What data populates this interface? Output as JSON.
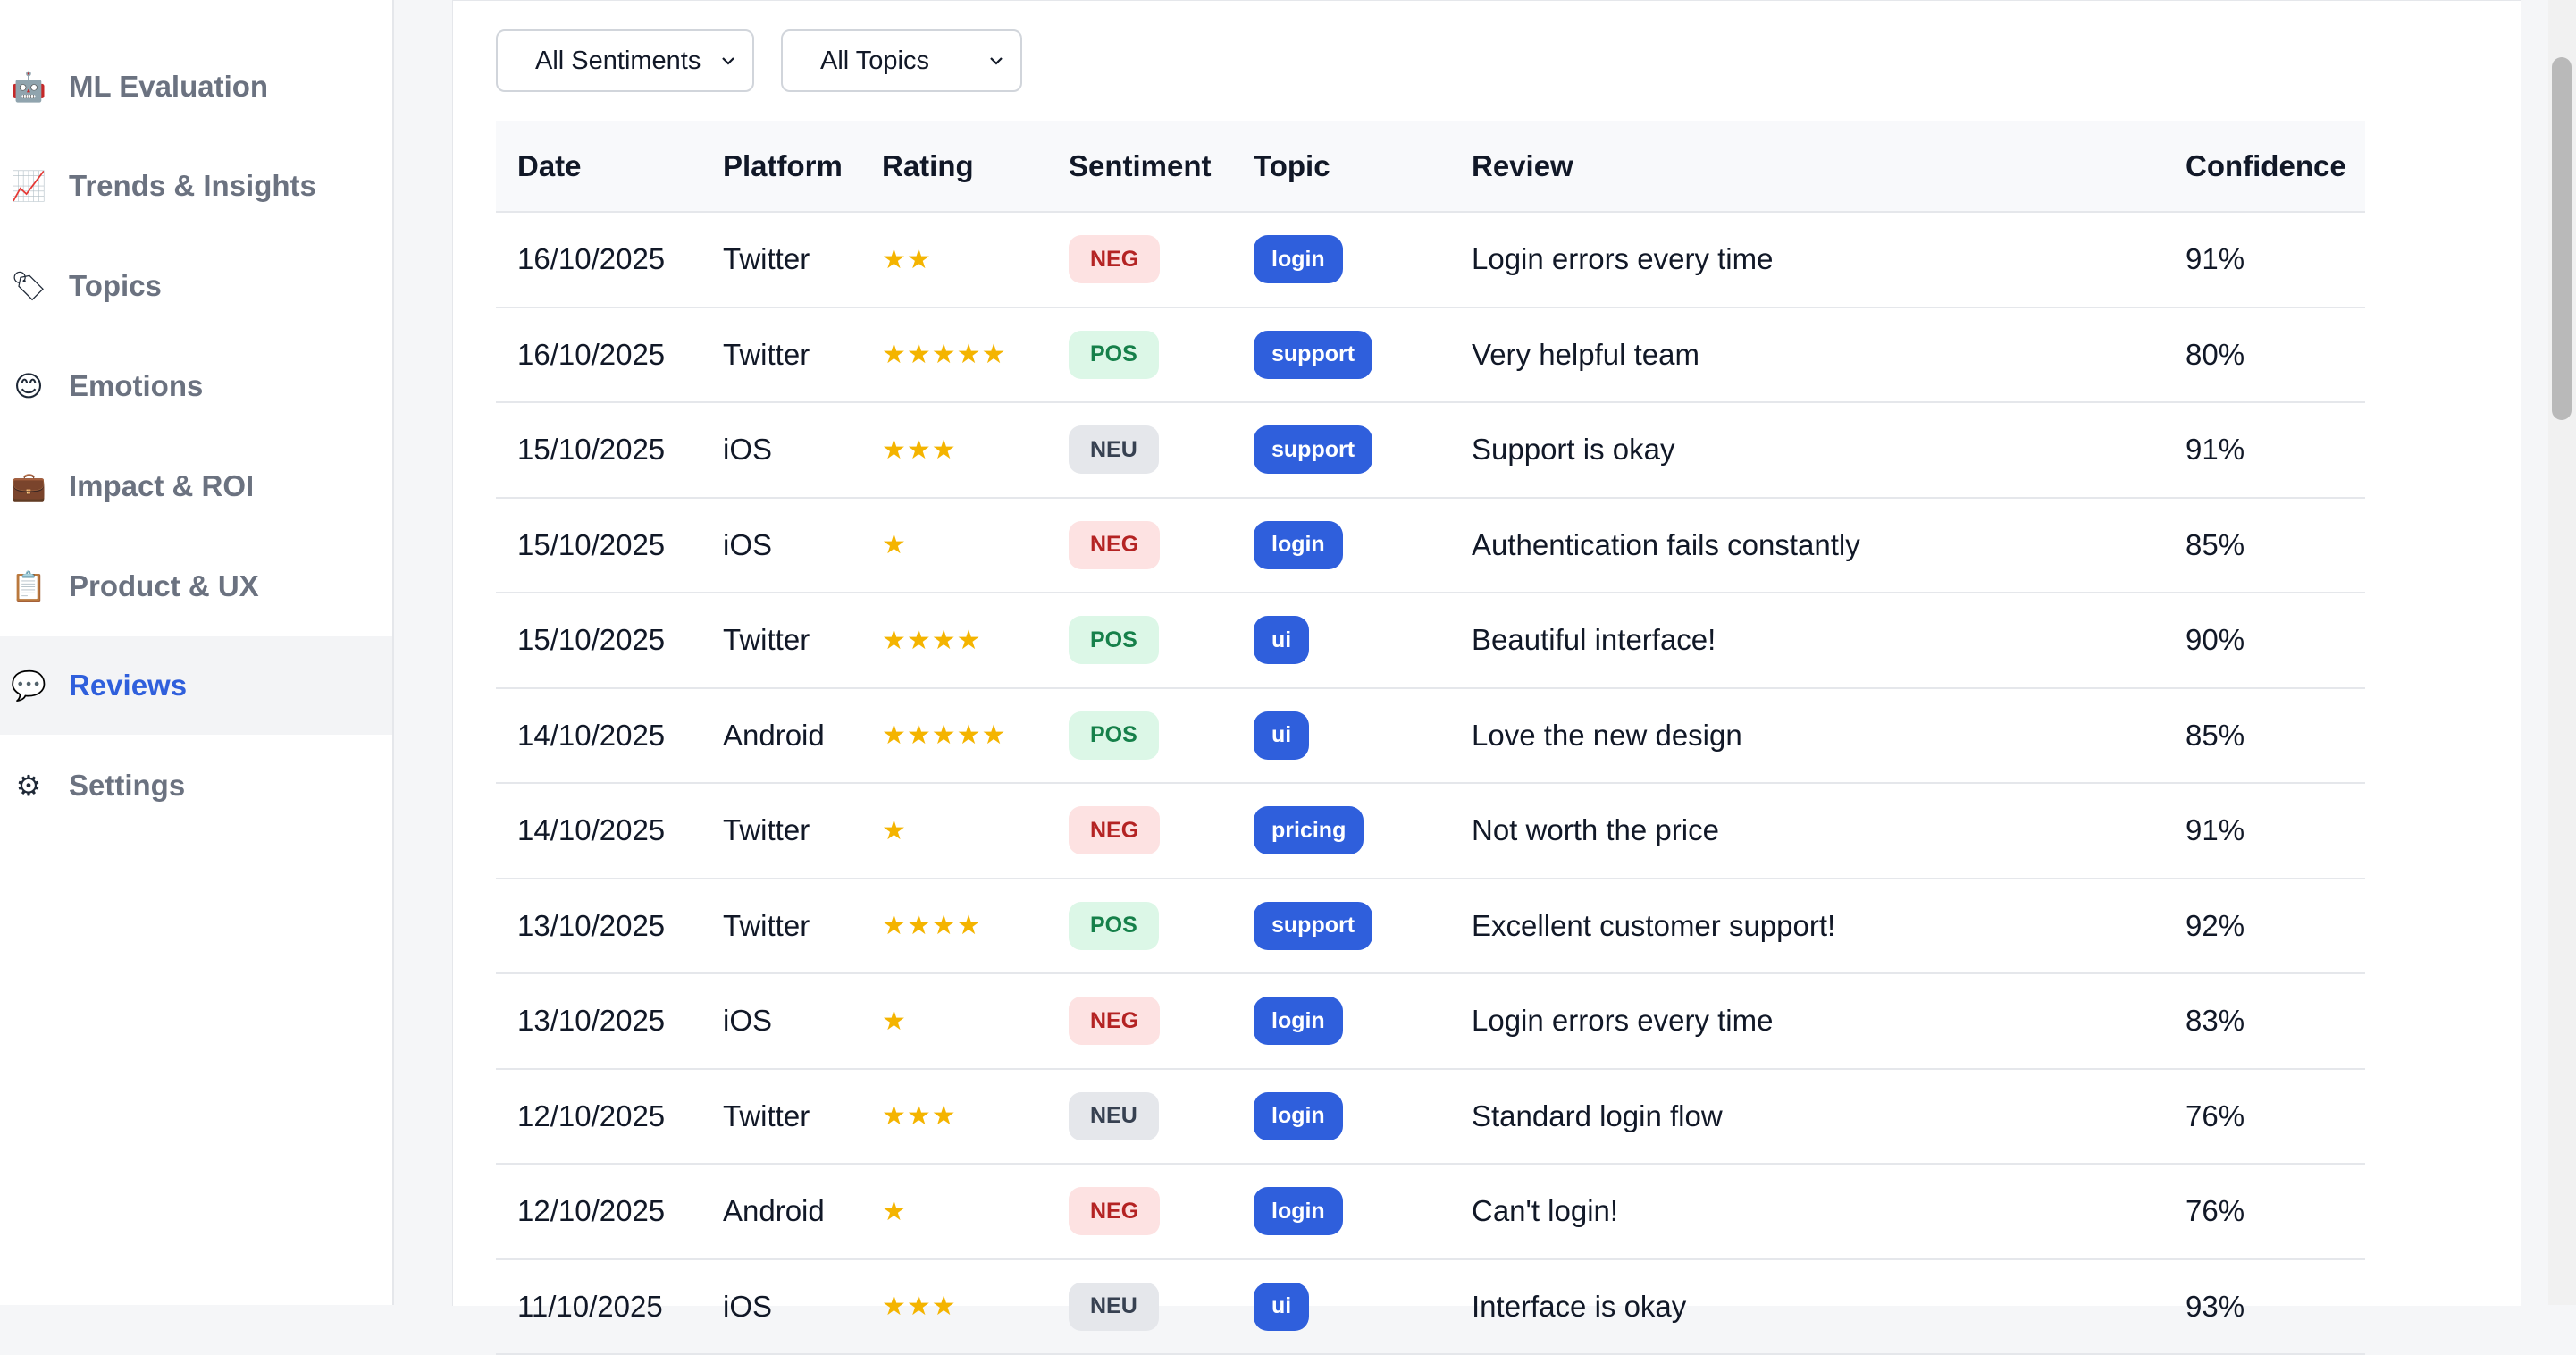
{
  "sidebar": {
    "items": [
      {
        "icon": "robot-icon",
        "glyph": "🤖",
        "label": "ML Evaluation",
        "active": false
      },
      {
        "icon": "chart-increasing-icon",
        "glyph": "📈",
        "label": "Trends & Insights",
        "active": false
      },
      {
        "icon": "tag-icon",
        "glyph": "🏷",
        "label": "Topics",
        "active": false
      },
      {
        "icon": "smiley-icon",
        "glyph": "😊",
        "label": "Emotions",
        "active": false
      },
      {
        "icon": "briefcase-icon",
        "glyph": "💼",
        "label": "Impact & ROI",
        "active": false
      },
      {
        "icon": "clipboard-icon",
        "glyph": "📋",
        "label": "Product & UX",
        "active": false
      },
      {
        "icon": "speech-bubble-icon",
        "glyph": "💬",
        "label": "Reviews",
        "active": true
      },
      {
        "icon": "gear-icon",
        "glyph": "⚙",
        "label": "Settings",
        "active": false
      }
    ]
  },
  "filters": {
    "sentiment": "All Sentiments",
    "topic": "All Topics"
  },
  "table": {
    "headers": {
      "date": "Date",
      "platform": "Platform",
      "rating": "Rating",
      "sentiment": "Sentiment",
      "topic": "Topic",
      "review": "Review",
      "confidence": "Confidence"
    },
    "rows": [
      {
        "date": "16/10/2025",
        "platform": "Twitter",
        "rating": 2,
        "sentiment": "NEG",
        "topic": "login",
        "review": "Login errors every time",
        "confidence": "91%"
      },
      {
        "date": "16/10/2025",
        "platform": "Twitter",
        "rating": 5,
        "sentiment": "POS",
        "topic": "support",
        "review": "Very helpful team",
        "confidence": "80%"
      },
      {
        "date": "15/10/2025",
        "platform": "iOS",
        "rating": 3,
        "sentiment": "NEU",
        "topic": "support",
        "review": "Support is okay",
        "confidence": "91%"
      },
      {
        "date": "15/10/2025",
        "platform": "iOS",
        "rating": 1,
        "sentiment": "NEG",
        "topic": "login",
        "review": "Authentication fails constantly",
        "confidence": "85%"
      },
      {
        "date": "15/10/2025",
        "platform": "Twitter",
        "rating": 4,
        "sentiment": "POS",
        "topic": "ui",
        "review": "Beautiful interface!",
        "confidence": "90%"
      },
      {
        "date": "14/10/2025",
        "platform": "Android",
        "rating": 5,
        "sentiment": "POS",
        "topic": "ui",
        "review": "Love the new design",
        "confidence": "85%"
      },
      {
        "date": "14/10/2025",
        "platform": "Twitter",
        "rating": 1,
        "sentiment": "NEG",
        "topic": "pricing",
        "review": "Not worth the price",
        "confidence": "91%"
      },
      {
        "date": "13/10/2025",
        "platform": "Twitter",
        "rating": 4,
        "sentiment": "POS",
        "topic": "support",
        "review": "Excellent customer support!",
        "confidence": "92%"
      },
      {
        "date": "13/10/2025",
        "platform": "iOS",
        "rating": 1,
        "sentiment": "NEG",
        "topic": "login",
        "review": "Login errors every time",
        "confidence": "83%"
      },
      {
        "date": "12/10/2025",
        "platform": "Twitter",
        "rating": 3,
        "sentiment": "NEU",
        "topic": "login",
        "review": "Standard login flow",
        "confidence": "76%"
      },
      {
        "date": "12/10/2025",
        "platform": "Android",
        "rating": 1,
        "sentiment": "NEG",
        "topic": "login",
        "review": "Can't login!",
        "confidence": "76%"
      },
      {
        "date": "11/10/2025",
        "platform": "iOS",
        "rating": 3,
        "sentiment": "NEU",
        "topic": "ui",
        "review": "Interface is okay",
        "confidence": "93%"
      }
    ]
  },
  "colors": {
    "accent": "#2f5fdc",
    "neg_bg": "#fde2e2",
    "pos_bg": "#dcf7e7",
    "neu_bg": "#e5e7eb",
    "star": "#f4b400"
  }
}
